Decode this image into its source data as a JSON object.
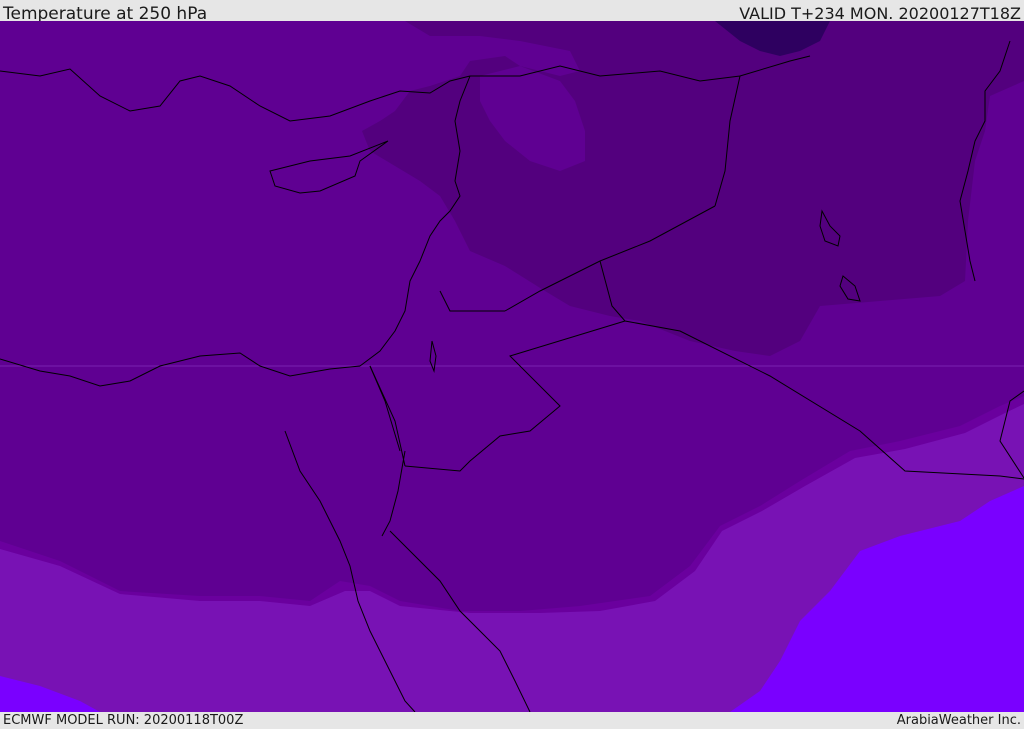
{
  "header": {
    "title": "Temperature at 250 hPa",
    "valid_time": "VALID T+234 MON. 20200127T18Z"
  },
  "footer": {
    "model_run": "ECMWF MODEL RUN: 20200118T00Z",
    "credit": "ArabiaWeather Inc."
  },
  "map": {
    "colors": {
      "darkest": "#2e0060",
      "dark": "#53007e",
      "base": "#5f0092",
      "mid": "#6a009e",
      "light": "#7812b4",
      "brightest": "#7a00ff",
      "border": "#000000"
    }
  }
}
